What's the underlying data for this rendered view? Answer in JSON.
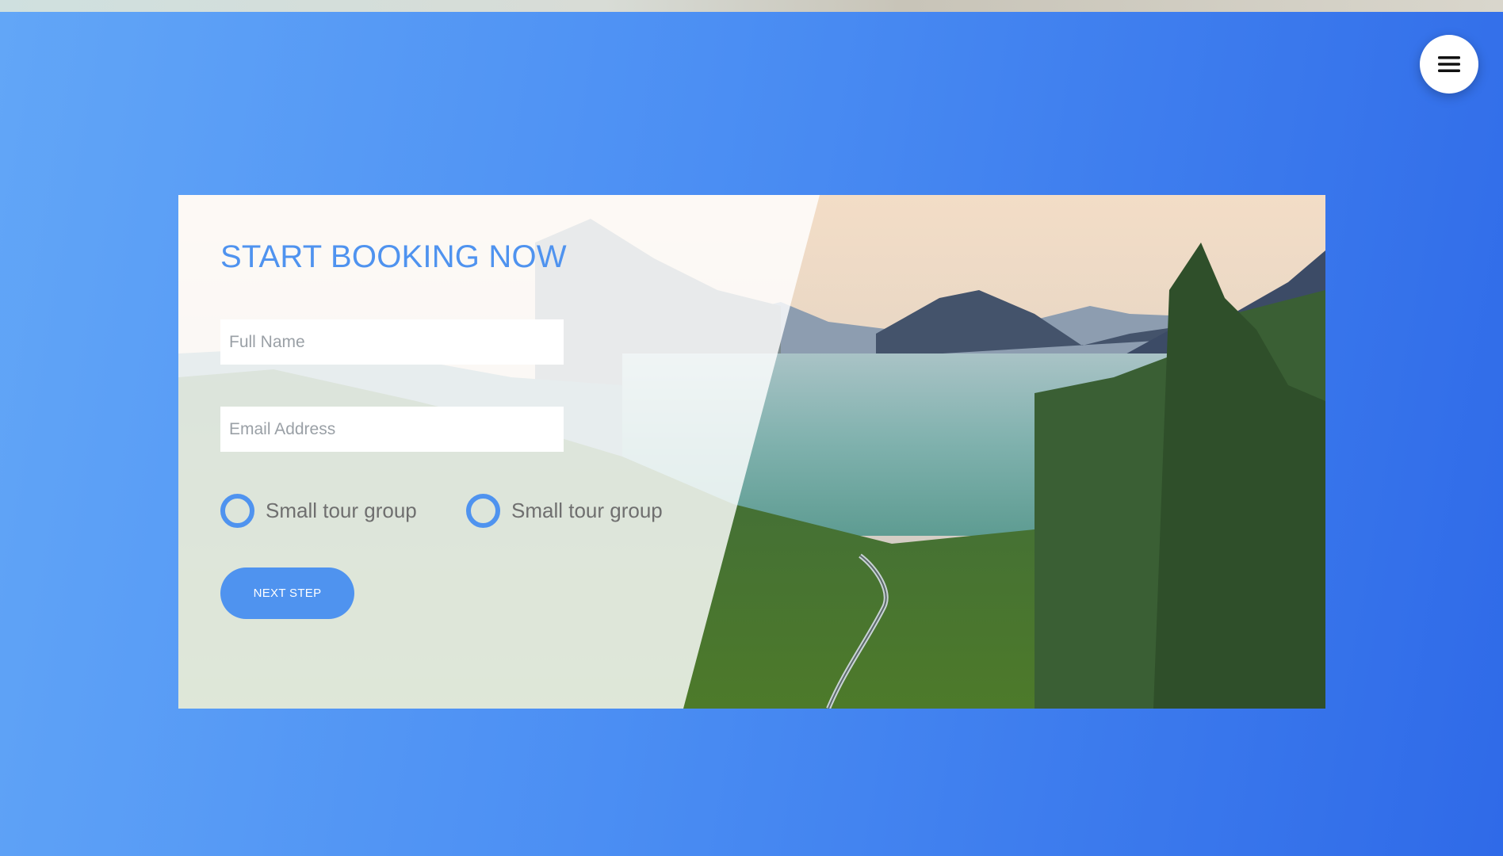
{
  "booking": {
    "title": "START BOOKING NOW",
    "full_name_placeholder": "Full Name",
    "email_placeholder": "Email Address",
    "options": [
      {
        "label": "Small tour group",
        "selected": false
      },
      {
        "label": "Small tour group",
        "selected": false
      }
    ],
    "next_label": "NEXT STEP"
  },
  "menu": {
    "icon": "hamburger-menu-icon"
  },
  "colors": {
    "accent": "#4f93ef",
    "background_start": "#62a6f7",
    "background_end": "#2f6ae8"
  }
}
